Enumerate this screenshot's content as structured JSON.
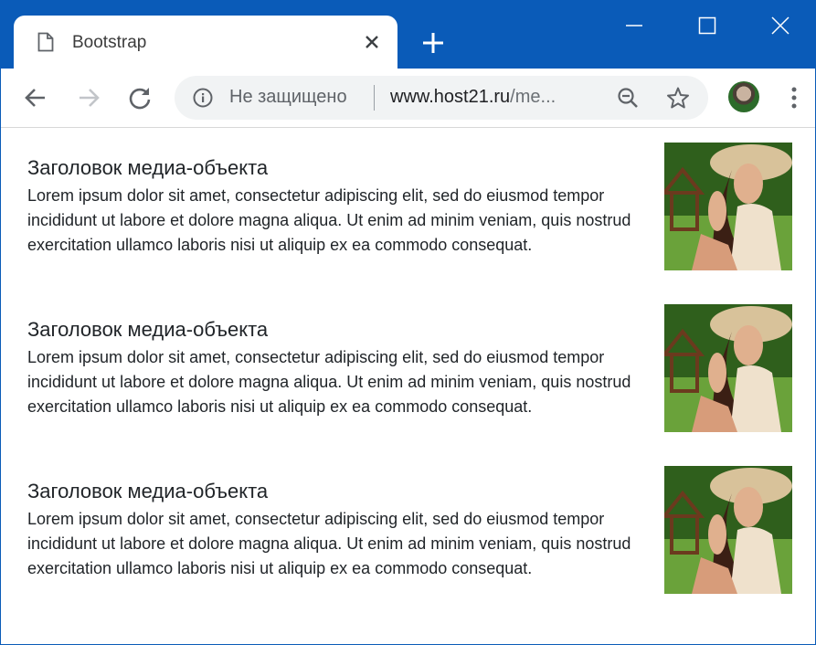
{
  "browser": {
    "tab_title": "Bootstrap",
    "address": {
      "security_text": "Не защищено",
      "url_host": "www.host21.ru",
      "url_path": "/me..."
    }
  },
  "media_items": [
    {
      "heading": "Заголовок медиа-объекта",
      "text": "Lorem ipsum dolor sit amet, consectetur adipiscing elit, sed do eiusmod tempor incididunt ut labore et dolore magna aliqua. Ut enim ad minim veniam, quis nostrud exercitation ullamco laboris nisi ut aliquip ex ea commodo consequat."
    },
    {
      "heading": "Заголовок медиа-объекта",
      "text": "Lorem ipsum dolor sit amet, consectetur adipiscing elit, sed do eiusmod tempor incididunt ut labore et dolore magna aliqua. Ut enim ad minim veniam, quis nostrud exercitation ullamco laboris nisi ut aliquip ex ea commodo consequat."
    },
    {
      "heading": "Заголовок медиа-объекта",
      "text": "Lorem ipsum dolor sit amet, consectetur adipiscing elit, sed do eiusmod tempor incididunt ut labore et dolore magna aliqua. Ut enim ad minim veniam, quis nostrud exercitation ullamco laboris nisi ut aliquip ex ea commodo consequat."
    }
  ],
  "colors": {
    "titlebar": "#0a5bb8",
    "text": "#212529"
  },
  "icons": [
    "document-icon",
    "close-icon",
    "plus-icon",
    "minimize-icon",
    "maximize-icon",
    "close-window-icon",
    "back-icon",
    "forward-icon",
    "reload-icon",
    "info-icon",
    "zoom-out-icon",
    "star-icon",
    "more-vert-icon"
  ]
}
